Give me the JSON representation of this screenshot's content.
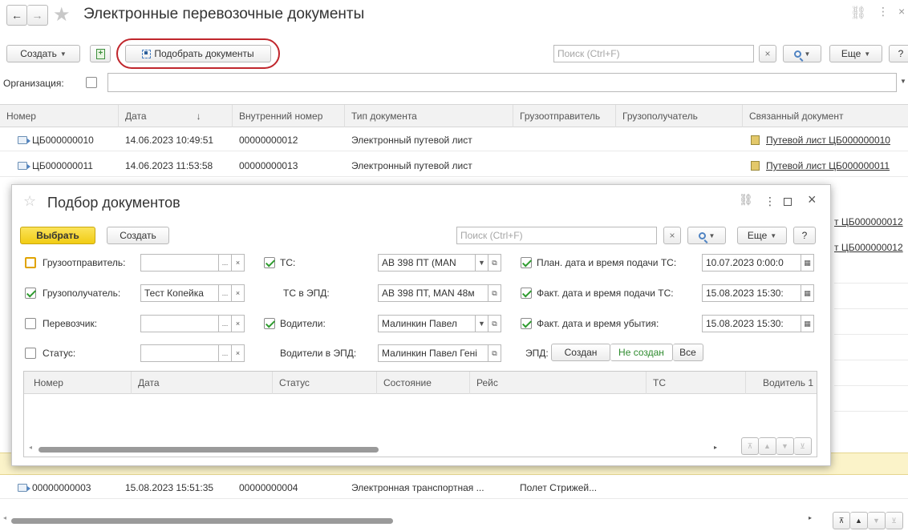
{
  "window": {
    "title": "Электронные перевозочные документы",
    "back_icon": "arrow-left-icon",
    "forward_icon": "arrow-right-icon",
    "star_icon": "star-icon",
    "link_icon": "link-icon",
    "menu_icon": "more-vertical-icon",
    "close_glyph": "×"
  },
  "toolbar": {
    "create_label": "Создать",
    "pick_label": "Подобрать документы",
    "search_placeholder": "Поиск (Ctrl+F)",
    "clear_glyph": "×",
    "more_label": "Еще",
    "help_label": "?"
  },
  "filter": {
    "organization_label": "Организация:"
  },
  "table": {
    "columns": [
      "Номер",
      "Дата",
      "Внутренний номер",
      "Тип документа",
      "Грузоотправитель",
      "Грузополучатель",
      "Связанный документ"
    ],
    "sort_glyph": "↓",
    "rows": [
      {
        "number": "ЦБ000000010",
        "date": "14.06.2023 10:49:51",
        "internal": "00000000012",
        "type": "Электронный путевой лист",
        "shipper": "",
        "consignee": "",
        "linked": "Путевой лист ЦБ000000010"
      },
      {
        "number": "ЦБ000000011",
        "date": "14.06.2023 11:53:58",
        "internal": "00000000013",
        "type": "Электронный путевой лист",
        "shipper": "",
        "consignee": "",
        "linked": "Путевой лист ЦБ000000011"
      }
    ],
    "bottom_row": {
      "number": "00000000003",
      "date": "15.08.2023 15:51:35",
      "internal": "00000000004",
      "type": "Электронная транспортная ...",
      "shipper": "Полет Стрижей...",
      "consignee": "",
      "linked": ""
    },
    "partial_linked": [
      "т ЦБ000000012",
      "т ЦБ000000012"
    ]
  },
  "dialog": {
    "title": "Подбор документов",
    "select_label": "Выбрать",
    "create_label": "Создать",
    "search_placeholder": "Поиск (Ctrl+F)",
    "more_label": "Еще",
    "help_label": "?",
    "fields": {
      "shipper_label": "Грузоотправитель:",
      "consignee_label": "Грузополучатель:",
      "consignee_value": "Тест Копейка",
      "carrier_label": "Перевозчик:",
      "status_label": "Статус:",
      "vehicle_label": "ТС:",
      "vehicle_value": "АВ 398 ПТ (MAN",
      "vehicle_epd_label": "ТС в ЭПД:",
      "vehicle_epd_value": "АВ 398 ПТ, MAN  48м",
      "drivers_label": "Водители:",
      "drivers_value": "Малинкин Павел",
      "drivers_epd_label": "Водители в ЭПД:",
      "drivers_epd_value": "Малинкин Павел Гені",
      "plan_label": "План. дата и время подачи ТС:",
      "plan_value": "10.07.2023  0:00:0",
      "fact_label": "Факт. дата и время подачи ТС:",
      "fact_value": "15.08.2023 15:30:",
      "depart_label": "Факт. дата и время убытия:",
      "depart_value": "15.08.2023 15:30:",
      "epd_label": "ЭПД:",
      "epd_created": "Создан",
      "epd_not_created": "Не создан",
      "epd_all": "Все",
      "dots": "...",
      "clear": "×"
    },
    "grid_columns": [
      "Номер",
      "Дата",
      "Статус",
      "Состояние",
      "Рейс",
      "ТС",
      "Водитель 1"
    ],
    "colors": {
      "accent": "#f5d422",
      "check": "#2e9b2e",
      "highlight": "#c0262c"
    }
  }
}
